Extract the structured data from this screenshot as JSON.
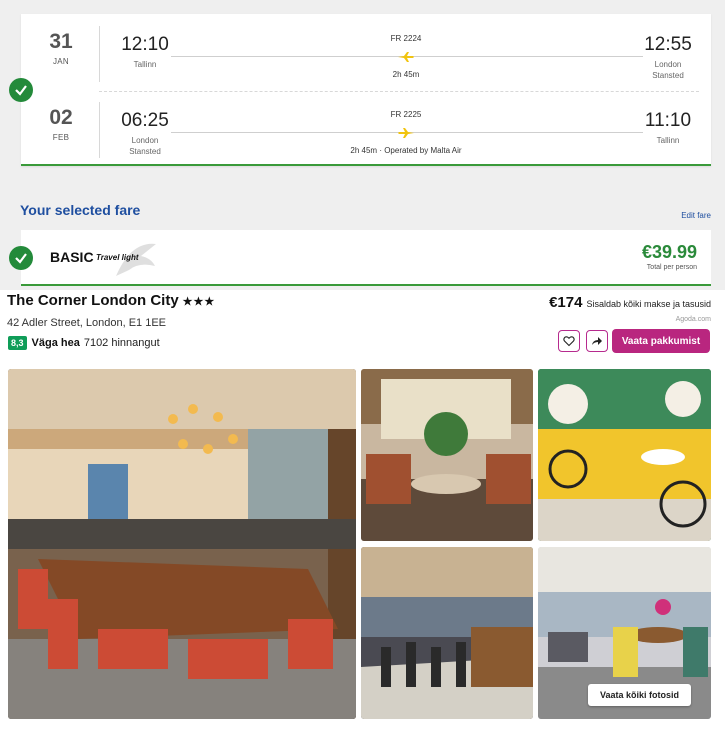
{
  "outbound": {
    "day": "31",
    "month": "JAN",
    "dep_time": "12:10",
    "dep_city": "Tallinn",
    "flight_no": "FR 2224",
    "duration": "2h 45m",
    "arr_time": "12:55",
    "arr_city_1": "London",
    "arr_city_2": "Stansted"
  },
  "inbound": {
    "day": "02",
    "month": "FEB",
    "dep_time": "06:25",
    "dep_city_1": "London",
    "dep_city_2": "Stansted",
    "flight_no": "FR 2225",
    "duration": "2h 45m · Operated by Malta Air",
    "arr_time": "11:10",
    "arr_city": "Tallinn"
  },
  "fare": {
    "section_title": "Your selected fare",
    "edit_label": "Edit fare",
    "name": "BASIC",
    "subtitle": "Travel light",
    "price": "€39.99",
    "price_note": "Total per person"
  },
  "hotel": {
    "name": "The Corner London City",
    "stars": "★★★",
    "address": "42 Adler Street, London, E1 1EE",
    "score": "8,3",
    "rating_label": "Väga hea",
    "reviews": "7102 hinnangut",
    "price": "€174",
    "price_note": "Sisaldab kõiki makse ja tasusid",
    "source": "Agoda.com",
    "deal_button": "Vaata pakkumist",
    "all_photos_button": "Vaata kõiki fotosid"
  },
  "icons": {
    "check": "check-icon",
    "plane": "plane-icon",
    "heart": "heart-icon",
    "share": "share-arrow-icon"
  },
  "colors": {
    "accent_blue": "#1f4fa0",
    "success_green": "#238a3a",
    "price_green": "#2a8a3a",
    "plane_yellow": "#f1c40f",
    "deal_magenta": "#b9267f",
    "score_green": "#0f9d58"
  }
}
